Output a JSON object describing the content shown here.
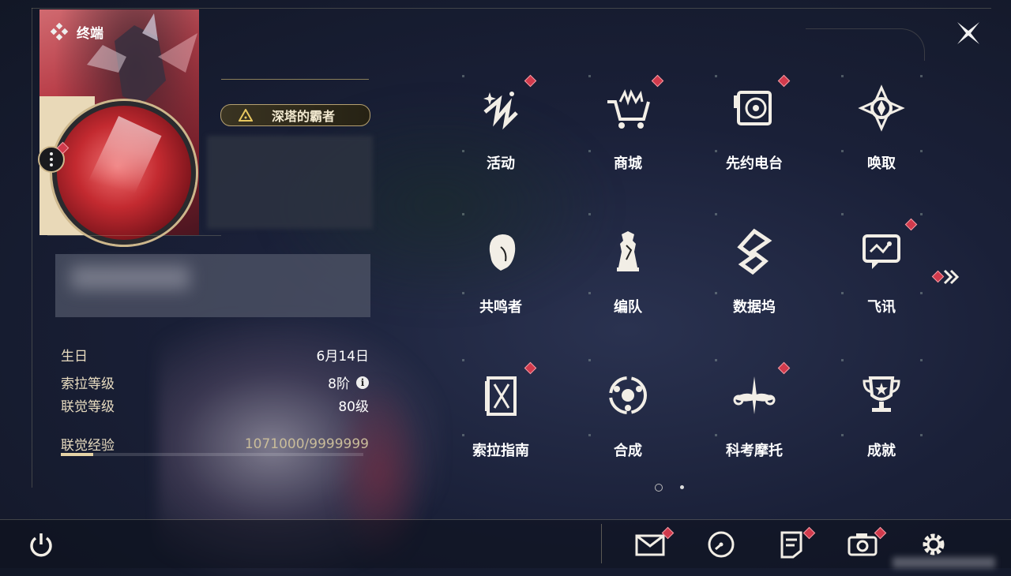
{
  "header": {
    "title": "终端",
    "title_icon": "diamond-cluster-icon",
    "close_icon": "close-icon"
  },
  "profile": {
    "avatar_card": "character-portrait",
    "more_icon": "more-vertical-icon",
    "badge_label": "深塔的霸者",
    "stats": {
      "birthday_label": "生日",
      "birthday_value": "6月14日",
      "sola_level_label": "索拉等级",
      "sola_level_value": "8阶",
      "union_level_label": "联觉等级",
      "union_level_value": "80级",
      "union_exp_label": "联觉经验",
      "union_exp_value": "1071000/9999999",
      "union_exp_progress": 0.107
    }
  },
  "menu": {
    "items": [
      {
        "label": "活动",
        "icon": "events-icon",
        "notify": true
      },
      {
        "label": "商城",
        "icon": "shop-cart-icon",
        "notify": true
      },
      {
        "label": "先约电台",
        "icon": "radio-icon",
        "notify": true
      },
      {
        "label": "唤取",
        "icon": "summon-icon",
        "notify": false
      },
      {
        "label": "共鸣者",
        "icon": "resonator-icon",
        "notify": false
      },
      {
        "label": "编队",
        "icon": "team-icon",
        "notify": false
      },
      {
        "label": "数据坞",
        "icon": "data-bank-icon",
        "notify": false
      },
      {
        "label": "飞讯",
        "icon": "message-icon",
        "notify": true
      },
      {
        "label": "索拉指南",
        "icon": "guide-icon",
        "notify": true
      },
      {
        "label": "合成",
        "icon": "synthesis-icon",
        "notify": false
      },
      {
        "label": "科考摩托",
        "icon": "motorcycle-icon",
        "notify": true
      },
      {
        "label": "成就",
        "icon": "trophy-icon",
        "notify": false
      }
    ],
    "pagination": {
      "current": 1,
      "total": 2
    }
  },
  "bottom_bar": {
    "icons": [
      "power-icon",
      "mail-icon",
      "time-icon",
      "notes-icon",
      "camera-icon",
      "settings-icon"
    ]
  },
  "colors": {
    "accent_gold": "#cdb78c",
    "notify_red": "#d13a4c",
    "text": "#ffffff"
  }
}
